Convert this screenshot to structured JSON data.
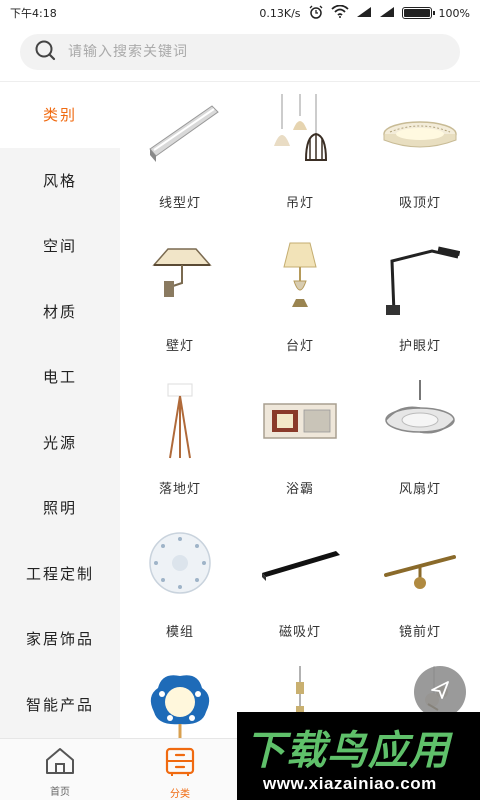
{
  "status_bar": {
    "time": "下午4:18",
    "net_speed": "0.13K/s",
    "battery": "100%",
    "battery_level": 1.0
  },
  "search": {
    "placeholder": "请输入搜索关键词",
    "icon": "search-icon"
  },
  "sidebar": {
    "items": [
      {
        "label": "类别",
        "active": true
      },
      {
        "label": "风格",
        "active": false
      },
      {
        "label": "空间",
        "active": false
      },
      {
        "label": "材质",
        "active": false
      },
      {
        "label": "电工",
        "active": false
      },
      {
        "label": "光源",
        "active": false
      },
      {
        "label": "照明",
        "active": false
      },
      {
        "label": "工程定制",
        "active": false
      },
      {
        "label": "家居饰品",
        "active": false
      },
      {
        "label": "智能产品",
        "active": false
      }
    ]
  },
  "products": [
    {
      "label": "线型灯",
      "icon": "linear-light-icon"
    },
    {
      "label": "吊灯",
      "icon": "pendant-lamp-icon"
    },
    {
      "label": "吸顶灯",
      "icon": "ceiling-lamp-icon"
    },
    {
      "label": "壁灯",
      "icon": "wall-lamp-icon"
    },
    {
      "label": "台灯",
      "icon": "table-lamp-icon"
    },
    {
      "label": "护眼灯",
      "icon": "desk-eye-lamp-icon"
    },
    {
      "label": "落地灯",
      "icon": "floor-lamp-icon"
    },
    {
      "label": "浴霸",
      "icon": "bath-heater-icon"
    },
    {
      "label": "风扇灯",
      "icon": "fan-light-icon"
    },
    {
      "label": "模组",
      "icon": "led-module-icon"
    },
    {
      "label": "磁吸灯",
      "icon": "magnetic-track-icon"
    },
    {
      "label": "镜前灯",
      "icon": "mirror-light-icon"
    },
    {
      "label": "",
      "icon": "kids-lamp-icon"
    },
    {
      "label": "",
      "icon": "hanging-lamp-icon"
    },
    {
      "label": "",
      "icon": "chandelier-icon"
    }
  ],
  "bottom_nav": [
    {
      "label": "首页",
      "icon": "home-icon",
      "active": false
    },
    {
      "label": "分类",
      "icon": "category-icon",
      "active": true
    }
  ],
  "watermark": {
    "title": "下载鸟应用",
    "url": "www.xiazainiao.com"
  },
  "colors": {
    "accent": "#f06a10",
    "sidebar_bg": "#f4f4f4",
    "watermark_green": "#5fc06a"
  }
}
